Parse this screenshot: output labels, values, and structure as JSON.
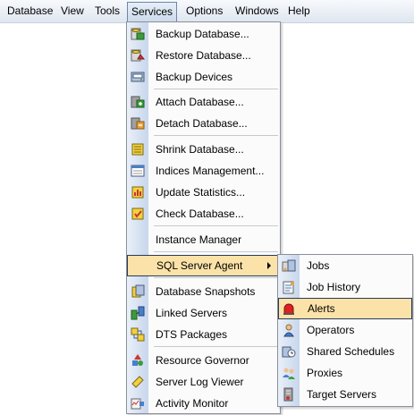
{
  "menubar": {
    "items": [
      {
        "label": "Database"
      },
      {
        "label": "View"
      },
      {
        "label": "Tools"
      },
      {
        "label": "Services"
      },
      {
        "label": "Options"
      },
      {
        "label": "Windows"
      },
      {
        "label": "Help"
      }
    ],
    "open_item": "Services"
  },
  "services_menu": {
    "items": [
      {
        "label": "Backup Database...",
        "icon": "backup-database-icon"
      },
      {
        "label": "Restore Database...",
        "icon": "restore-database-icon"
      },
      {
        "label": "Backup Devices",
        "icon": "backup-devices-icon"
      },
      {
        "label": "Attach Database...",
        "icon": "attach-database-icon"
      },
      {
        "label": "Detach Database...",
        "icon": "detach-database-icon"
      },
      {
        "label": "Shrink Database...",
        "icon": "shrink-database-icon"
      },
      {
        "label": "Indices Management...",
        "icon": "indices-management-icon"
      },
      {
        "label": "Update Statistics...",
        "icon": "update-statistics-icon"
      },
      {
        "label": "Check Database...",
        "icon": "check-database-icon"
      },
      {
        "label": "Instance Manager",
        "icon": ""
      },
      {
        "label": "SQL Server Agent",
        "icon": "",
        "submenu": true,
        "highlighted": true
      },
      {
        "label": "Database Snapshots",
        "icon": "database-snapshots-icon"
      },
      {
        "label": "Linked Servers",
        "icon": "linked-servers-icon"
      },
      {
        "label": "DTS Packages",
        "icon": "dts-packages-icon"
      },
      {
        "label": "Resource Governor",
        "icon": "resource-governor-icon"
      },
      {
        "label": "Server Log Viewer",
        "icon": "server-log-viewer-icon"
      },
      {
        "label": "Activity Monitor",
        "icon": "activity-monitor-icon"
      }
    ]
  },
  "agent_submenu": {
    "items": [
      {
        "label": "Jobs",
        "icon": "jobs-icon"
      },
      {
        "label": "Job History",
        "icon": "job-history-icon"
      },
      {
        "label": "Alerts",
        "icon": "alerts-icon",
        "highlighted": true
      },
      {
        "label": "Operators",
        "icon": "operators-icon"
      },
      {
        "label": "Shared Schedules",
        "icon": "shared-schedules-icon"
      },
      {
        "label": "Proxies",
        "icon": "proxies-icon"
      },
      {
        "label": "Target Servers",
        "icon": "target-servers-icon"
      }
    ]
  },
  "colors": {
    "highlight_bg": "#fbe2a8",
    "highlight_border": "#2b3a55",
    "gutter": "#c7d6ec",
    "menu_border": "#8a8f99"
  }
}
